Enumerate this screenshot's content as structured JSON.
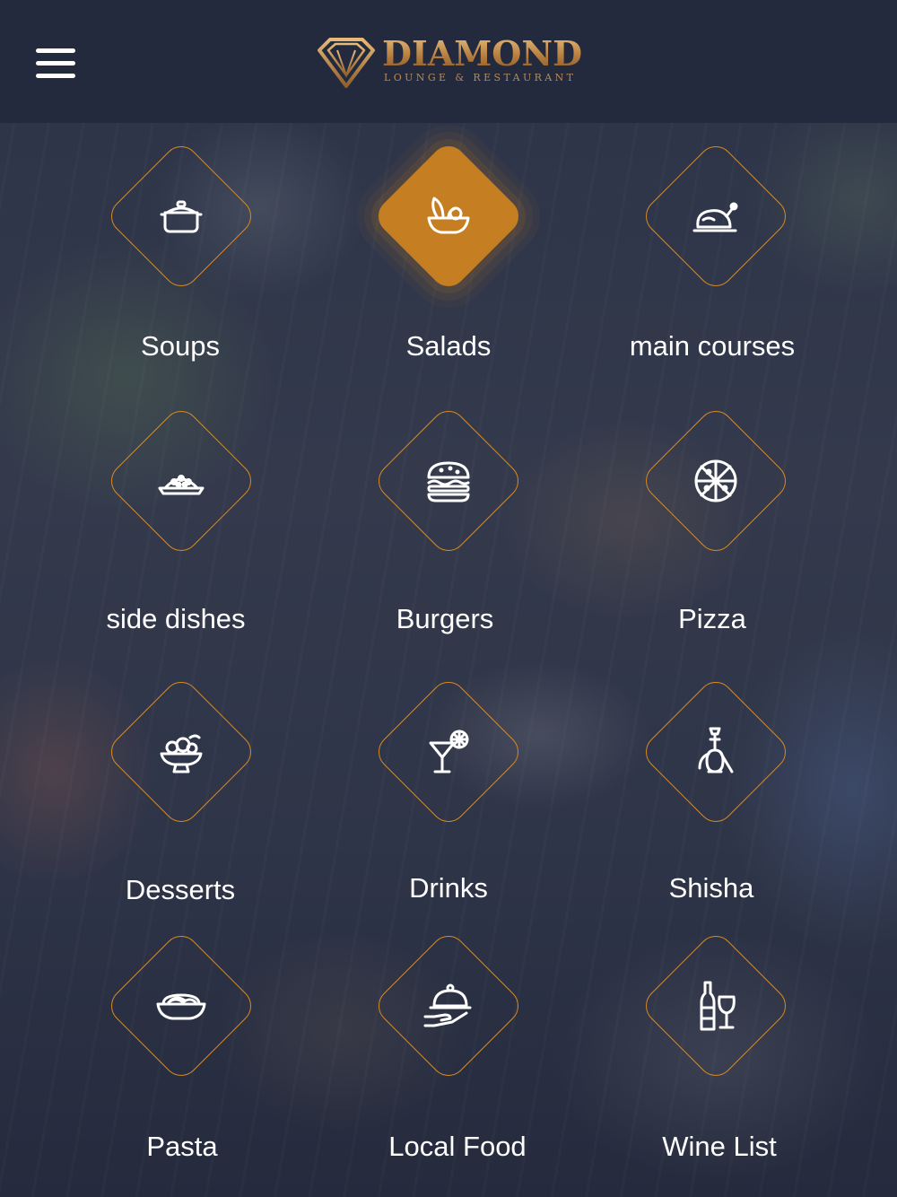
{
  "header": {
    "brand_name": "DIAMOND",
    "brand_tagline": "LOUNGE & RESTAURANT",
    "menu_icon": "hamburger-icon"
  },
  "accent_color": "#d98a1f",
  "active_color": "#c57e22",
  "categories": [
    {
      "label": "Soups",
      "icon": "pot-icon"
    },
    {
      "label": "Salads",
      "icon": "salad-bowl-icon",
      "selected": true
    },
    {
      "label": "main courses",
      "icon": "roast-chicken-icon"
    },
    {
      "label": "side dishes",
      "icon": "side-dish-icon"
    },
    {
      "label": "Burgers",
      "icon": "burger-icon"
    },
    {
      "label": "Pizza",
      "icon": "pizza-icon"
    },
    {
      "label": "Desserts",
      "icon": "dessert-icon"
    },
    {
      "label": "Drinks",
      "icon": "cocktail-icon"
    },
    {
      "label": "Shisha",
      "icon": "hookah-icon"
    },
    {
      "label": "Pasta",
      "icon": "pasta-icon"
    },
    {
      "label": "Local Food",
      "icon": "cloche-icon"
    },
    {
      "label": "Wine List",
      "icon": "wine-icon"
    }
  ]
}
